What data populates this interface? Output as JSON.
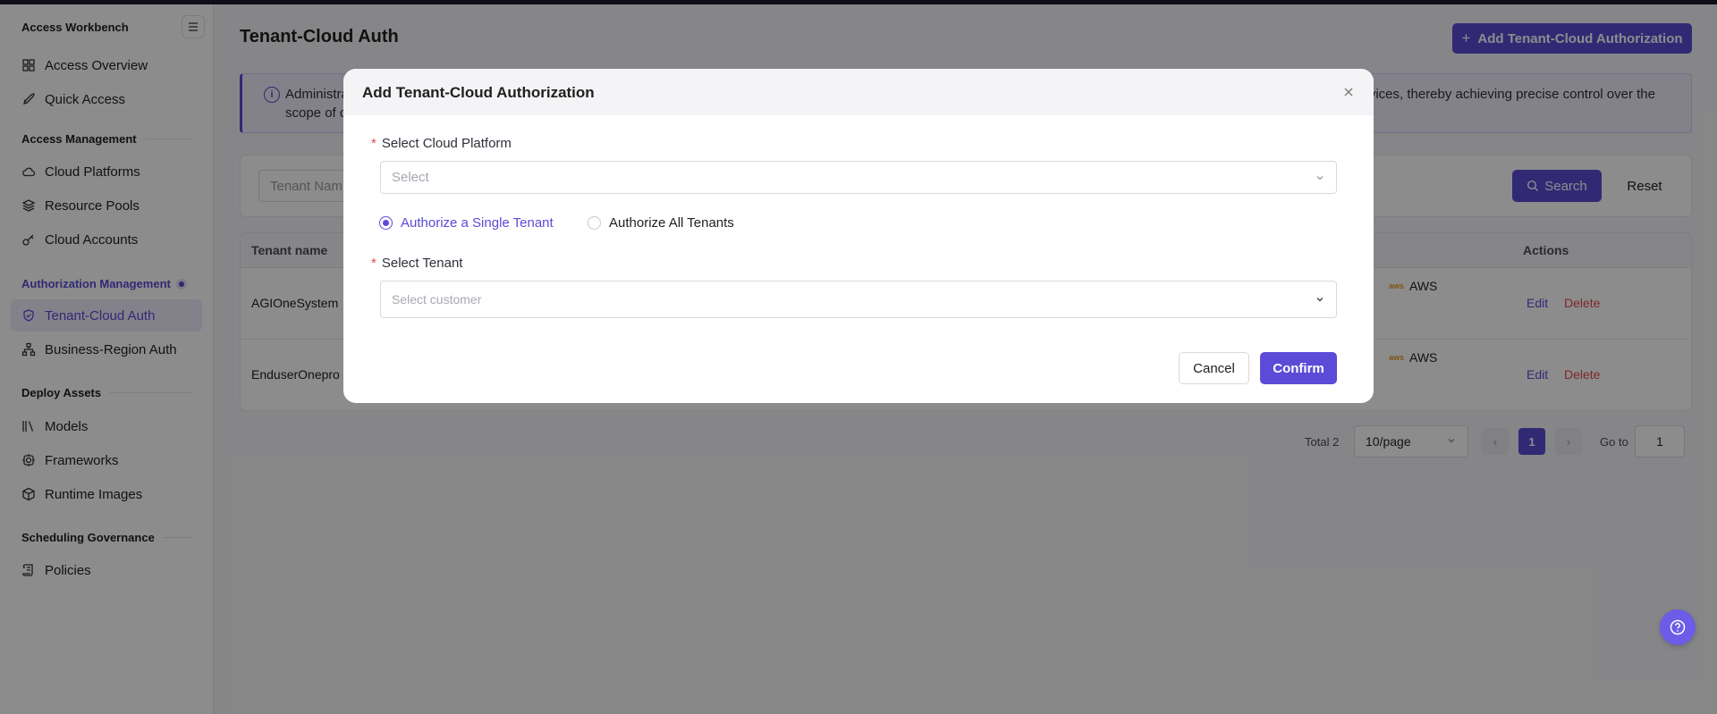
{
  "sidebar": {
    "header": "Access Workbench",
    "groups": {
      "access_management": "Access Management",
      "authorization_management": "Authorization Management",
      "deploy_assets": "Deploy Assets",
      "scheduling_governance": "Scheduling Governance"
    },
    "items": {
      "access_overview": "Access Overview",
      "quick_access": "Quick Access",
      "cloud_platforms": "Cloud Platforms",
      "resource_pools": "Resource Pools",
      "cloud_accounts": "Cloud Accounts",
      "tenant_cloud_auth": "Tenant-Cloud Auth",
      "business_region_auth": "Business-Region Auth",
      "models": "Models",
      "frameworks": "Frameworks",
      "runtime_images": "Runtime Images",
      "policies": "Policies"
    }
  },
  "header": {
    "title": "Tenant-Cloud Auth",
    "add_button": "Add Tenant-Cloud Authorization"
  },
  "banner": {
    "line1_left": "Administra",
    "line1_right": "vices, thereby achieving precise control over the",
    "line2_left": "scope of c"
  },
  "filters": {
    "tenant_name_placeholder": "Tenant Nam",
    "search": "Search",
    "reset": "Reset"
  },
  "table": {
    "headers": {
      "tenant_name": "Tenant name",
      "actions": "Actions"
    },
    "rows": [
      {
        "tenant": "AGIOneSystem",
        "cloud": "AWS",
        "edit": "Edit",
        "delete": "Delete"
      },
      {
        "tenant": "EnduserOnepro",
        "cloud": "AWS",
        "edit": "Edit",
        "delete": "Delete"
      }
    ]
  },
  "pagination": {
    "total": "Total 2",
    "page_size": "10/page",
    "current_page": "1",
    "goto_label": "Go to",
    "goto_value": "1"
  },
  "modal": {
    "title": "Add Tenant-Cloud Authorization",
    "cloud_platform_label": "Select Cloud Platform",
    "cloud_platform_placeholder": "Select",
    "radio_single": "Authorize a Single Tenant",
    "radio_all": "Authorize All Tenants",
    "tenant_label": "Select Tenant",
    "tenant_placeholder": "Select customer",
    "required_mark": "*",
    "cancel": "Cancel",
    "confirm": "Confirm"
  },
  "colors": {
    "accent": "#5b4bd6",
    "danger": "#e5484d",
    "overlay": "rgba(0,0,0,0.45)"
  },
  "icons": [
    "menu-icon",
    "grid-icon",
    "rocket-icon",
    "cloud-icon",
    "layers-icon",
    "key-icon",
    "shield-icon",
    "sitemap-icon",
    "library-icon",
    "gear-icon",
    "box-icon",
    "scroll-icon",
    "plus-icon",
    "info-icon",
    "search-icon",
    "chevron-down-icon",
    "close-icon",
    "help-icon"
  ]
}
